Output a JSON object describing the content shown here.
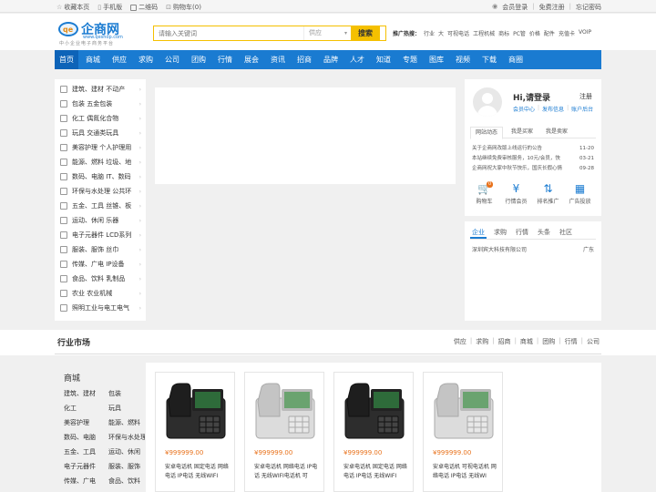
{
  "topbar": {
    "left": [
      {
        "label": "收藏本页",
        "icon": "star-icon"
      },
      {
        "label": "手机版",
        "icon": "mobile-icon"
      },
      {
        "label": "二维码",
        "icon": "qrcode-icon"
      },
      {
        "label": "购物车(0)",
        "icon": "cart-icon"
      }
    ],
    "right": {
      "login": "会员登录",
      "sep1": "|",
      "register": "免费注册",
      "sep2": "|",
      "forgot": "忘记密码"
    }
  },
  "logo": {
    "badge": "qe",
    "name": "企商网",
    "url": "www.qeshop.com",
    "slogan": "中小企业电子商务平台"
  },
  "search": {
    "placeholder": "请输入关键词",
    "scope": "供应",
    "scope_arrow": "▾",
    "button": "搜索"
  },
  "hot": {
    "label": "推广热搜：",
    "items": [
      "行业",
      "大",
      "可视电话",
      "工程机械",
      "商标",
      "PC管",
      "价格",
      "配件",
      "充值卡",
      "VOIP"
    ]
  },
  "nav": [
    "首页",
    "商城",
    "供应",
    "求购",
    "公司",
    "团购",
    "行情",
    "展会",
    "资讯",
    "招商",
    "品牌",
    "人才",
    "知道",
    "专题",
    "图库",
    "视频",
    "下载",
    "商圈"
  ],
  "categories": [
    "建筑、建材 不动产",
    "包装 五金包装",
    "化工 偶氮化合物",
    "玩具 交通类玩具",
    "美容护理 个人护理用",
    "能源、燃料 垃圾、地",
    "数码、电脑 IT、数码",
    "环保与水处理 公共环",
    "五金、工具 丝锥、板",
    "运动、休闲 乐器",
    "电子元器件 LCD系列",
    "服装、服饰 丝巾",
    "传媒、广电 IP设备",
    "食品、饮料 乳制品",
    "农业 农业机械",
    "照明工业与电工电气"
  ],
  "category_arrow": "›",
  "user": {
    "greeting": "Hi,请登录",
    "register": "注册",
    "links": [
      "会员中心",
      "发布信息",
      "账户后台"
    ],
    "link_sep": "|",
    "tabs": [
      "网站动态",
      "我是买家",
      "我是卖家"
    ],
    "news": [
      {
        "title": "关于企商网改版上线运行的公告",
        "date": "11-20"
      },
      {
        "title": "本站继续免费审核服务，10元/会员，快",
        "date": "03-21"
      },
      {
        "title": "企商网祝大家中秋节快乐，国庆长假心情",
        "date": "09-28"
      }
    ],
    "services": [
      {
        "label": "购物车",
        "icon": "cart-icon",
        "glyph": "🛒",
        "badge": "0"
      },
      {
        "label": "行情会员",
        "icon": "yen-icon",
        "glyph": "¥"
      },
      {
        "label": "排名推广",
        "icon": "sort-icon",
        "glyph": "⇅"
      },
      {
        "label": "广告投放",
        "icon": "grid-icon",
        "glyph": "▦"
      }
    ]
  },
  "companies": {
    "tabs": [
      "企业",
      "求购",
      "行情",
      "头条",
      "社区"
    ],
    "rows": [
      {
        "name": "深圳宾大科技有限公司",
        "area": "广东"
      }
    ]
  },
  "market": {
    "title": "行业市场",
    "links": [
      "供应",
      "求购",
      "招商",
      "商城",
      "团购",
      "行情",
      "公司"
    ],
    "link_sep": "|",
    "cat_title": "商城",
    "cats": [
      "建筑、建材",
      "包装",
      "化工",
      "玩具",
      "美容护理",
      "能源、燃料",
      "数码、电脑",
      "环保与水处理",
      "五金、工具",
      "运动、休闲",
      "电子元器件",
      "服装、服饰",
      "传媒、广电",
      "食品、饮料"
    ],
    "products": [
      {
        "price": "¥999999.00",
        "desc": "安卓电话机 固定电话 网络电话 IP电话 无线WIFI",
        "color": "dark"
      },
      {
        "price": "¥999999.00",
        "desc": "安卓电话机 网络电话 IP电话 无线WIFI电话机 可",
        "color": "light"
      },
      {
        "price": "¥999999.00",
        "desc": "安卓电话机 固定电话 网络电话 IP电话 无线WIFI",
        "color": "dark"
      },
      {
        "price": "¥999999.00",
        "desc": "安卓电话机 可视电话机 网络电话 IP电话 无线WI",
        "color": "light"
      }
    ]
  },
  "colors": {
    "primary": "#1a7bd1",
    "accent": "#f5c000",
    "price": "#e8721c"
  }
}
